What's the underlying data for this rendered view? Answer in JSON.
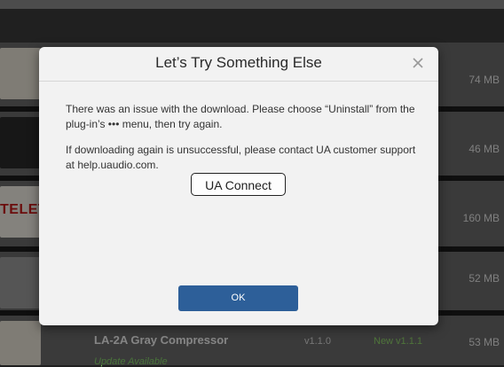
{
  "background": {
    "rows": [
      {
        "size": "74 MB"
      },
      {
        "size": "46 MB"
      },
      {
        "size": "160 MB",
        "thumb_text": "TELETR"
      },
      {
        "size": "52 MB"
      },
      {
        "size": "53 MB",
        "name": "LA-2A Gray Compressor",
        "version": "v1.1.0",
        "new_version": "New v1.1.1",
        "status": "Update Available"
      }
    ]
  },
  "dialog": {
    "title": "Let’s Try Something Else",
    "close_icon": "close-icon",
    "paragraph1": "There was an issue with the download.  Please choose “Uninstall” from the plug-in’s ••• menu, then try again.",
    "paragraph2": "If downloading again is unsuccessful, please contact UA customer support at help.uaudio.com.",
    "link_button": "UA Connect",
    "ok_button": "OK"
  },
  "colors": {
    "ok_button": "#2d5f99",
    "update_green": "#86d26c"
  }
}
